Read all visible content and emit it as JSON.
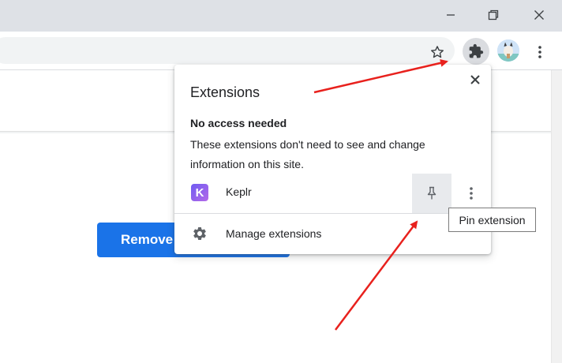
{
  "window": {
    "controls": [
      "minimize-icon",
      "restore-icon",
      "close-icon"
    ]
  },
  "toolbar": {
    "icons": [
      "star-icon",
      "extensions-puzzle-icon",
      "avatar",
      "more-vert-icon"
    ]
  },
  "page": {
    "button_label": "Remove"
  },
  "extensions_popup": {
    "title": "Extensions",
    "section_title": "No access needed",
    "section_description": "These extensions don't need to see and change information on this site.",
    "extension": {
      "icon_letter": "K",
      "name": "Keplr"
    },
    "manage_label": "Manage extensions"
  },
  "tooltip": {
    "text": "Pin extension"
  },
  "colors": {
    "accent_button": "#1a73e8",
    "annotation_arrow": "#e8211d",
    "extension_icon": "#7a5cf0"
  }
}
